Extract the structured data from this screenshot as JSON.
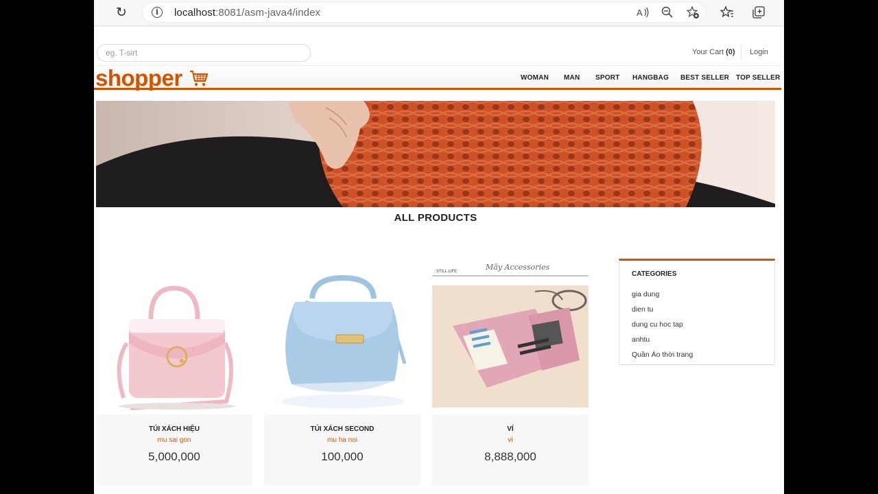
{
  "browser": {
    "url_host": "localhost",
    "url_path": ":8081/asm-java4/index"
  },
  "header": {
    "search_placeholder": "eg. T-sirt",
    "cart_label": "Your Cart",
    "cart_count": "(0)",
    "login_label": "Login",
    "logo_text": "shopper"
  },
  "nav": {
    "items": [
      {
        "label": "WOMAN"
      },
      {
        "label": "MAN"
      },
      {
        "label": "SPORT"
      },
      {
        "label": "HANGBAG"
      },
      {
        "label": "BEST SELLER"
      },
      {
        "label": "TOP SELLER"
      }
    ]
  },
  "main": {
    "section_title": "ALL PRODUCTS",
    "products": [
      {
        "name": "TÚI XÁCH HIỆU",
        "category": "mu sai gon",
        "price": "5,000,000"
      },
      {
        "name": "TÚI XÁCH SECOND",
        "category": "mu ha noi",
        "price": "100,000"
      },
      {
        "name": "VÍ",
        "category": "vi",
        "price": "8,888,000"
      }
    ],
    "wallet_image_text": {
      "brand": "Mây Accessories",
      "tag": "STILL LIFE"
    }
  },
  "sidebar": {
    "title": "CATEGORIES",
    "items": [
      {
        "label": "gia dung"
      },
      {
        "label": "dien tu"
      },
      {
        "label": "dung cu hoc tap"
      },
      {
        "label": "anhtu"
      },
      {
        "label": "Quần Áo thời trang"
      }
    ]
  },
  "colors": {
    "accent": "#d35400",
    "bag_pink": "#f2c4cc",
    "bag_blue": "#a9cbe6",
    "scarf": "#e0592c"
  }
}
